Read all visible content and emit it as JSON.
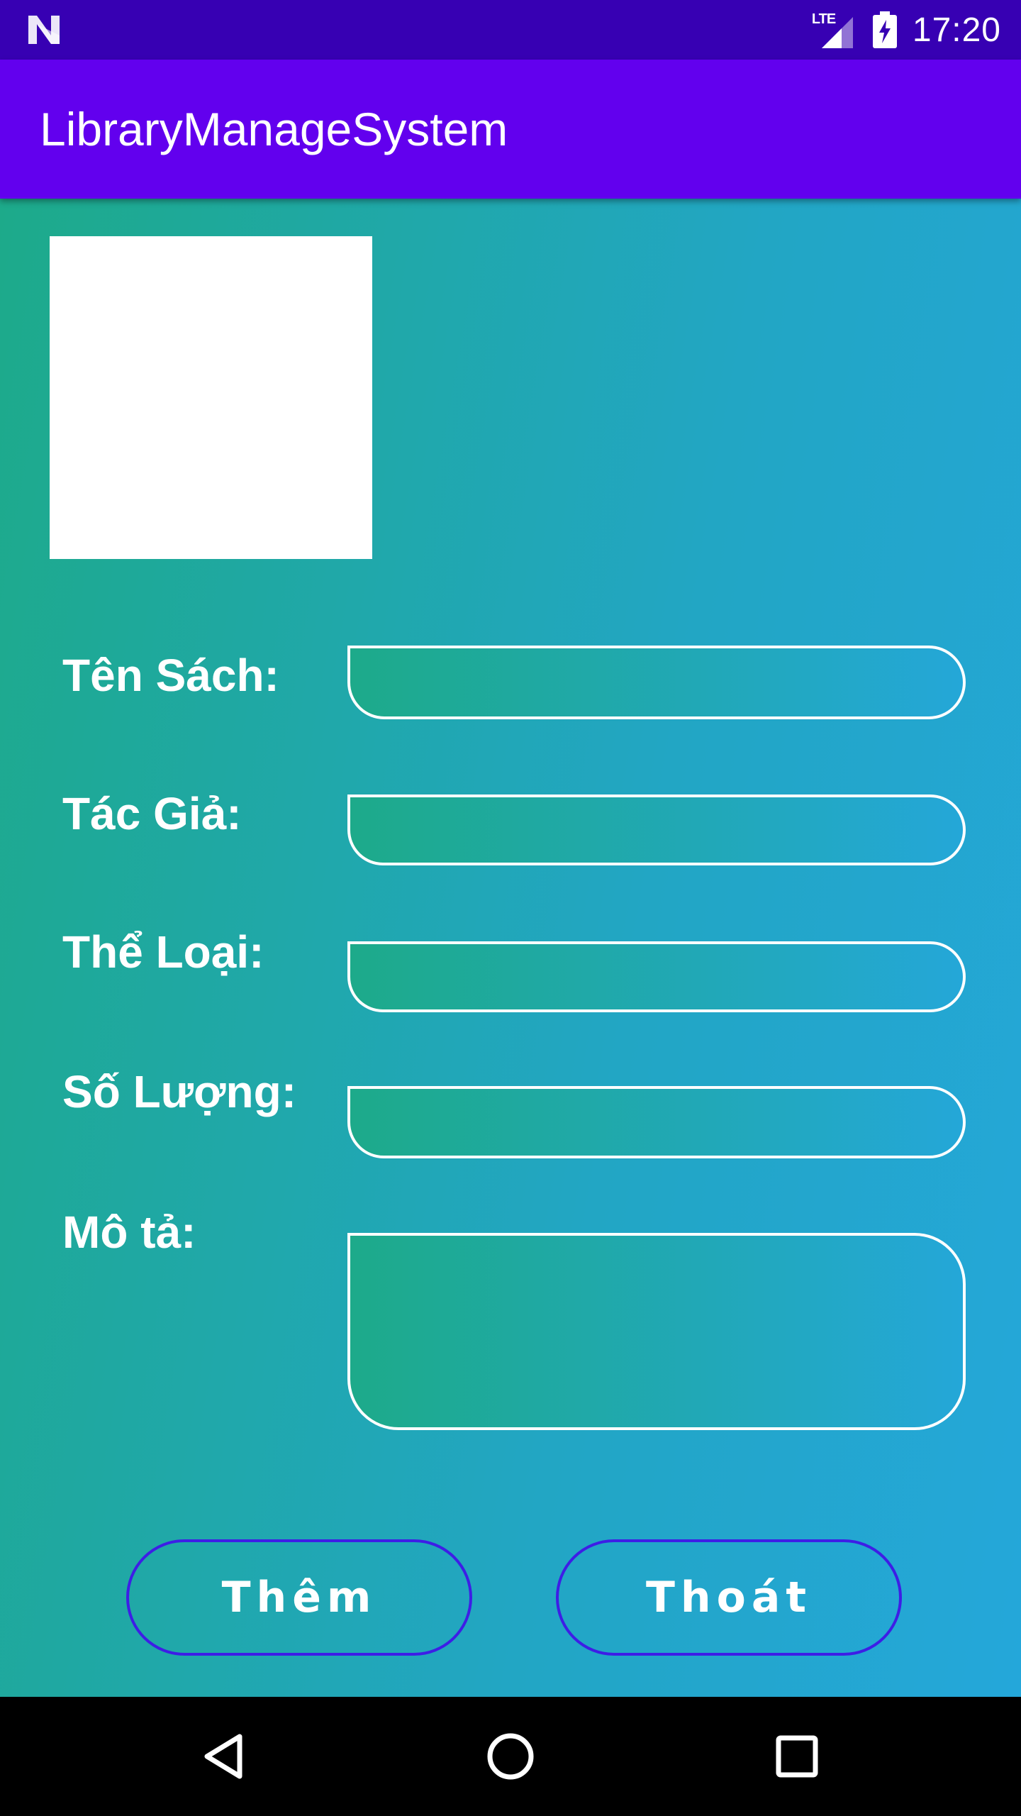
{
  "status_bar": {
    "network_label": "LTE",
    "time": "17:20",
    "icons": [
      "android-n-icon",
      "signal-icon",
      "battery-charging-icon"
    ]
  },
  "app_bar": {
    "title": "LibraryManageSystem"
  },
  "form": {
    "fields": [
      {
        "label": "Tên Sách:",
        "value": ""
      },
      {
        "label": "Tác Giả:",
        "value": ""
      },
      {
        "label": "Thể Loại:",
        "value": ""
      },
      {
        "label": "Số Lượng:",
        "value": ""
      },
      {
        "label": "Mô tả:",
        "value": ""
      }
    ],
    "add_label": "Thêm",
    "exit_label": "Thoát"
  },
  "nav_bar": {
    "icons": [
      "back-icon",
      "home-icon",
      "recents-icon"
    ]
  },
  "colors": {
    "status_bar": "#3700B3",
    "app_bar": "#6200EE",
    "gradient_start": "#1daa8a",
    "gradient_end": "#24a7da",
    "button_border": "#3d1ee6"
  }
}
